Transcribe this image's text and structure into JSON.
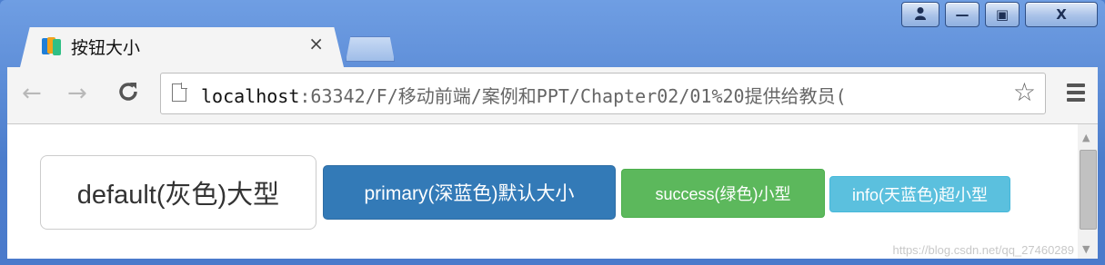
{
  "window": {
    "caption": {
      "user_icon": "user-icon",
      "minimize_glyph": "—",
      "maximize_glyph": "▣",
      "close_glyph": "X"
    }
  },
  "tab": {
    "title": "按钮大小",
    "close_glyph": "×",
    "favicon": "webstorm-icon"
  },
  "toolbar": {
    "back_glyph": "←",
    "forward_glyph": "→",
    "reload_glyph": "C",
    "url_host": "localhost",
    "url_rest": ":63342/F/移动前端/案例和PPT/Chapter02/01%20提供给教员(",
    "star_glyph": "☆"
  },
  "content": {
    "buttons": {
      "default": "default(灰色)大型",
      "primary": "primary(深蓝色)默认大小",
      "success": "success(绿色)小型",
      "info": "info(天蓝色)超小型"
    },
    "watermark": "https://blog.csdn.net/qq_27460289"
  },
  "colors": {
    "default_bg": "#ffffff",
    "primary_bg": "#337ab7",
    "success_bg": "#5cb85c",
    "info_bg": "#5bc0de",
    "window_frame": "#4d7fcf"
  }
}
